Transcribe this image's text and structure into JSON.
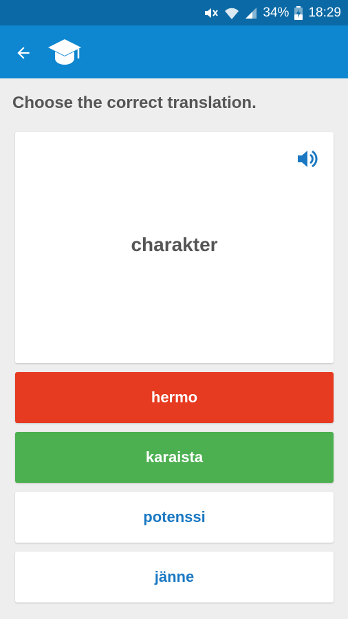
{
  "status_bar": {
    "battery_percent": "34%",
    "time": "18:29",
    "icons": [
      "mute-icon",
      "wifi-icon",
      "signal-icon",
      "battery-icon"
    ]
  },
  "app_bar": {
    "back_icon": "arrow-back-icon",
    "app_icon": "graduation-cap-icon",
    "color": "#0e86d0"
  },
  "quiz": {
    "prompt": "Choose the correct translation.",
    "word": "charakter",
    "speaker_icon": "speaker-icon",
    "options": [
      {
        "label": "hermo",
        "state": "wrong",
        "color": "#e63a21"
      },
      {
        "label": "karaista",
        "state": "correct",
        "color": "#4caf50"
      },
      {
        "label": "potenssi",
        "state": "neutral",
        "color": "#ffffff"
      },
      {
        "label": "jänne",
        "state": "neutral",
        "color": "#ffffff"
      }
    ]
  }
}
